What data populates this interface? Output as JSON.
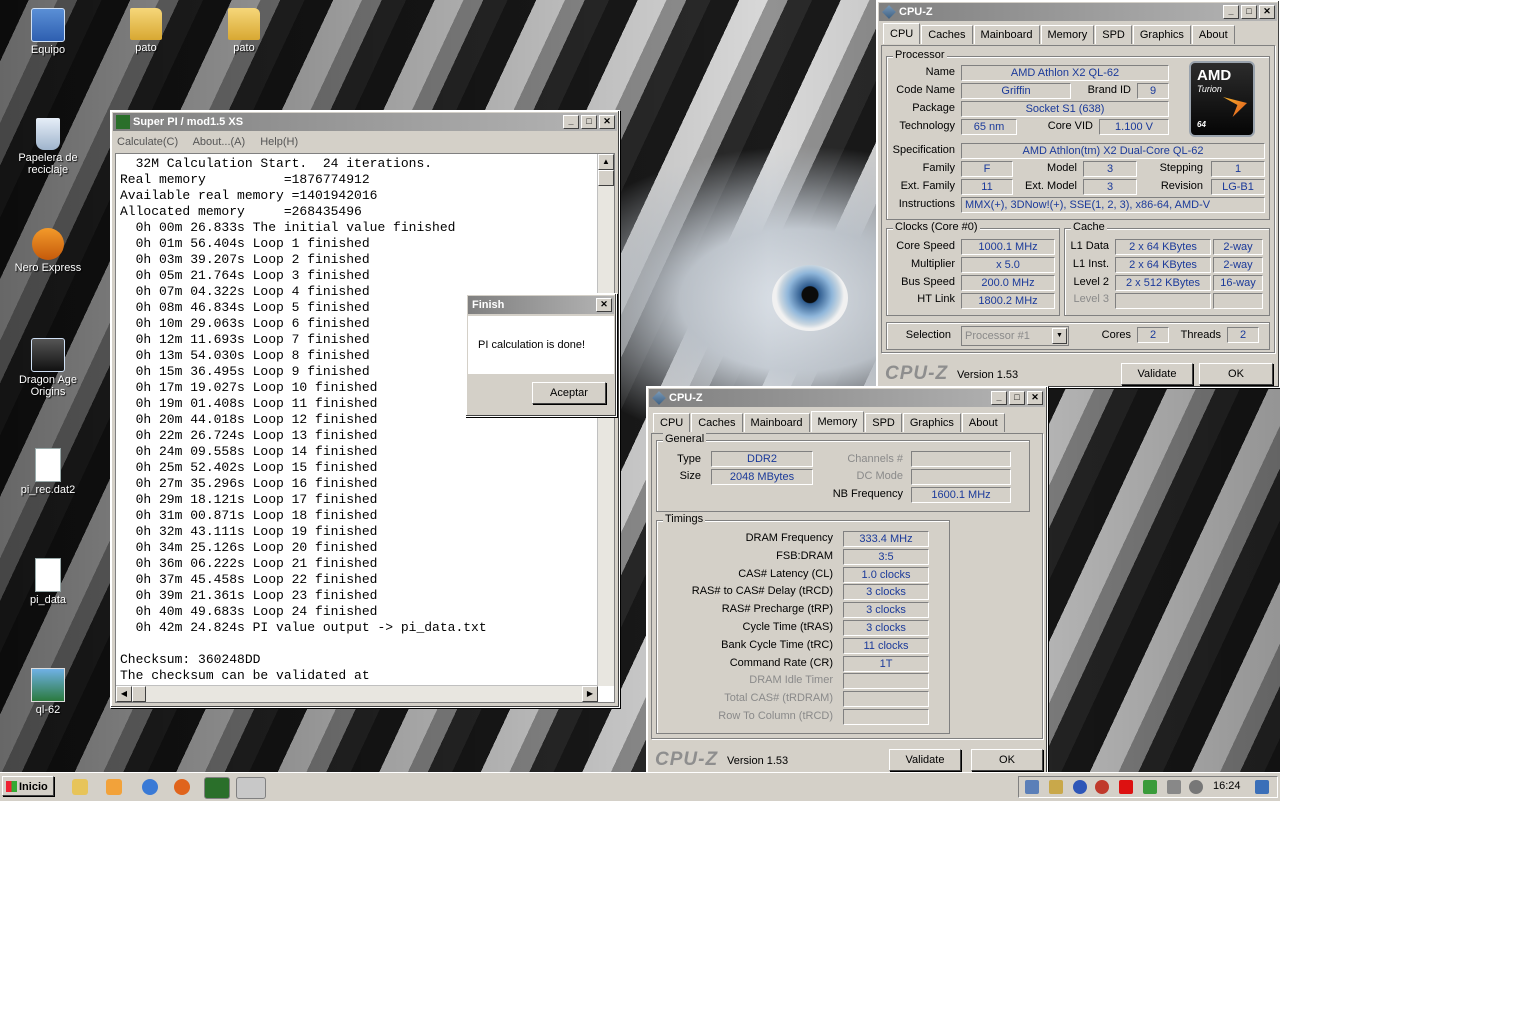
{
  "desktop": {
    "icons": [
      "Equipo",
      "pato",
      "pato",
      "Papelera de reciclaje",
      "Nero Express",
      "Dragon Age Origins",
      "pi_rec.dat2",
      "pi_data",
      "ql-62"
    ]
  },
  "superpi": {
    "title": "Super PI / mod1.5 XS",
    "menu": [
      "Calculate(C)",
      "About...(A)",
      "Help(H)"
    ],
    "lines": [
      "  32M Calculation Start.  24 iterations.",
      "Real memory          =1876774912",
      "Available real memory =1401942016",
      "Allocated memory     =268435496",
      "  0h 00m 26.833s The initial value finished",
      "  0h 01m 56.404s Loop 1 finished",
      "  0h 03m 39.207s Loop 2 finished",
      "  0h 05m 21.764s Loop 3 finished",
      "  0h 07m 04.322s Loop 4 finished",
      "  0h 08m 46.834s Loop 5 finished",
      "  0h 10m 29.063s Loop 6 finished",
      "  0h 12m 11.693s Loop 7 finished",
      "  0h 13m 54.030s Loop 8 finished",
      "  0h 15m 36.495s Loop 9 finished",
      "  0h 17m 19.027s Loop 10 finished",
      "  0h 19m 01.408s Loop 11 finished",
      "  0h 20m 44.018s Loop 12 finished",
      "  0h 22m 26.724s Loop 13 finished",
      "  0h 24m 09.558s Loop 14 finished",
      "  0h 25m 52.402s Loop 15 finished",
      "  0h 27m 35.296s Loop 16 finished",
      "  0h 29m 18.121s Loop 17 finished",
      "  0h 31m 00.871s Loop 18 finished",
      "  0h 32m 43.111s Loop 19 finished",
      "  0h 34m 25.126s Loop 20 finished",
      "  0h 36m 06.222s Loop 21 finished",
      "  0h 37m 45.458s Loop 22 finished",
      "  0h 39m 21.361s Loop 23 finished",
      "  0h 40m 49.683s Loop 24 finished",
      "  0h 42m 24.824s PI value output -> pi_data.txt",
      "",
      "Checksum: 360248DD",
      "The checksum can be validated at"
    ]
  },
  "finish": {
    "title": "Finish",
    "message": "PI calculation is done!",
    "ok": "Aceptar"
  },
  "cpuz_cpu": {
    "title": "CPU-Z",
    "tabs": [
      "CPU",
      "Caches",
      "Mainboard",
      "Memory",
      "SPD",
      "Graphics",
      "About"
    ],
    "processor": {
      "group": "Processor",
      "name_label": "Name",
      "name": "AMD Athlon X2 QL-62",
      "codename_label": "Code Name",
      "codename": "Griffin",
      "brandid_label": "Brand ID",
      "brandid": "9",
      "package_label": "Package",
      "package": "Socket S1 (638)",
      "technology_label": "Technology",
      "technology": "65 nm",
      "corevid_label": "Core VID",
      "corevid": "1.100 V",
      "spec_label": "Specification",
      "spec": "AMD Athlon(tm) X2 Dual-Core QL-62",
      "family_label": "Family",
      "family": "F",
      "model_label": "Model",
      "model": "3",
      "stepping_label": "Stepping",
      "stepping": "1",
      "extfamily_label": "Ext. Family",
      "extfamily": "11",
      "extmodel_label": "Ext. Model",
      "extmodel": "3",
      "revision_label": "Revision",
      "revision": "LG-B1",
      "instr_label": "Instructions",
      "instr": "MMX(+), 3DNow!(+), SSE(1, 2, 3), x86-64, AMD-V"
    },
    "logo": {
      "brand": "AMD",
      "sub": "Turion",
      "num": "64"
    },
    "clocks": {
      "group": "Clocks (Core #0)",
      "corespeed_label": "Core Speed",
      "corespeed": "1000.1 MHz",
      "multiplier_label": "Multiplier",
      "multiplier": "x 5.0",
      "busspeed_label": "Bus Speed",
      "busspeed": "200.0 MHz",
      "htlink_label": "HT Link",
      "htlink": "1800.2 MHz"
    },
    "cache": {
      "group": "Cache",
      "l1d_label": "L1 Data",
      "l1d": "2 x 64 KBytes",
      "l1d_way": "2-way",
      "l1i_label": "L1 Inst.",
      "l1i": "2 x 64 KBytes",
      "l1i_way": "2-way",
      "l2_label": "Level 2",
      "l2": "2 x 512 KBytes",
      "l2_way": "16-way",
      "l3_label": "Level 3"
    },
    "selection_label": "Selection",
    "selection": "Processor #1",
    "cores_label": "Cores",
    "cores": "2",
    "threads_label": "Threads",
    "threads": "2",
    "brand": "CPU-Z",
    "version": "Version 1.53",
    "validate": "Validate",
    "ok": "OK"
  },
  "cpuz_mem": {
    "title": "CPU-Z",
    "tabs": [
      "CPU",
      "Caches",
      "Mainboard",
      "Memory",
      "SPD",
      "Graphics",
      "About"
    ],
    "general": {
      "group": "General",
      "type_label": "Type",
      "type": "DDR2",
      "size_label": "Size",
      "size": "2048 MBytes",
      "channels_label": "Channels #",
      "dcmode_label": "DC Mode",
      "nbfreq_label": "NB Frequency",
      "nbfreq": "1600.1 MHz"
    },
    "timings": {
      "group": "Timings",
      "rows": [
        {
          "label": "DRAM Frequency",
          "value": "333.4 MHz",
          "dim": false
        },
        {
          "label": "FSB:DRAM",
          "value": "3:5",
          "dim": false
        },
        {
          "label": "CAS# Latency (CL)",
          "value": "1.0 clocks",
          "dim": false
        },
        {
          "label": "RAS# to CAS# Delay (tRCD)",
          "value": "3 clocks",
          "dim": false
        },
        {
          "label": "RAS# Precharge (tRP)",
          "value": "3 clocks",
          "dim": false
        },
        {
          "label": "Cycle Time (tRAS)",
          "value": "3 clocks",
          "dim": false
        },
        {
          "label": "Bank Cycle Time (tRC)",
          "value": "11 clocks",
          "dim": false
        },
        {
          "label": "Command Rate (CR)",
          "value": "1T",
          "dim": false
        },
        {
          "label": "DRAM Idle Timer",
          "value": "",
          "dim": true
        },
        {
          "label": "Total CAS# (tRDRAM)",
          "value": "",
          "dim": true
        },
        {
          "label": "Row To Column (tRCD)",
          "value": "",
          "dim": true
        }
      ]
    },
    "brand": "CPU-Z",
    "version": "Version 1.53",
    "validate": "Validate",
    "ok": "OK"
  },
  "taskbar": {
    "start": "Inicio",
    "clock": "16:24"
  }
}
